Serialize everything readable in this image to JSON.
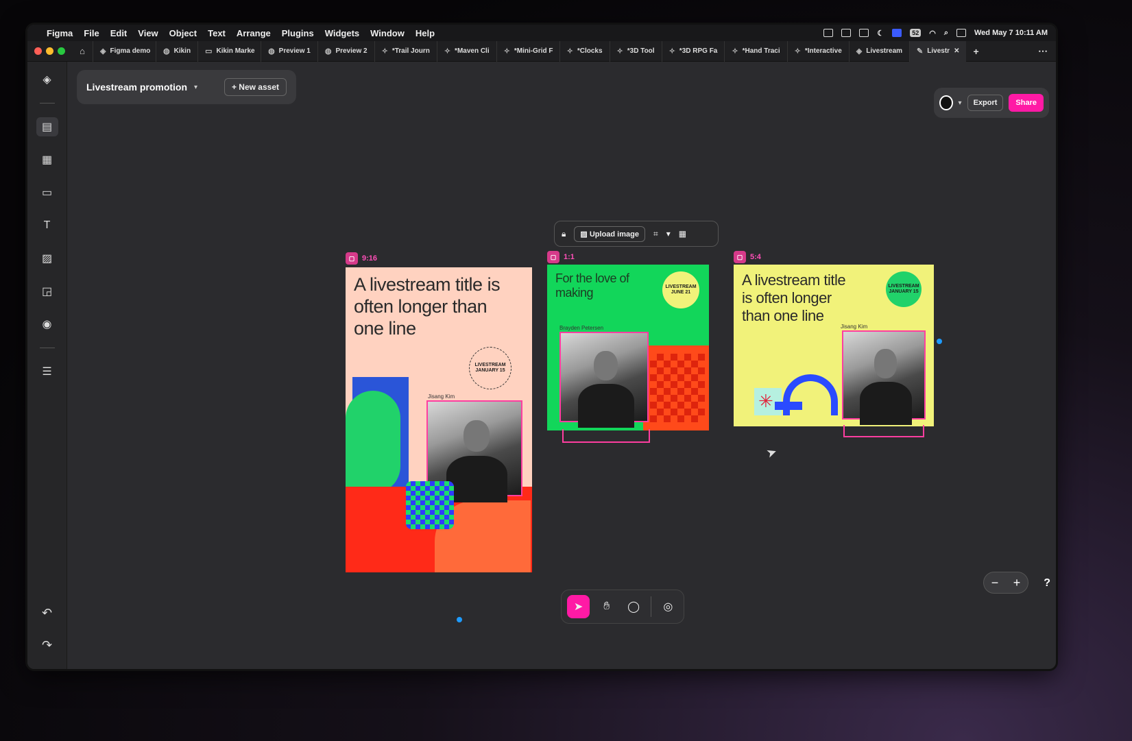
{
  "menubar": {
    "app": "Figma",
    "items": [
      "File",
      "Edit",
      "View",
      "Object",
      "Text",
      "Arrange",
      "Plugins",
      "Widgets",
      "Window",
      "Help"
    ],
    "battery": "52",
    "datetime": "Wed May 7  10:11 AM"
  },
  "tabs": [
    {
      "label": "Figma demo",
      "icon": "figma-icon"
    },
    {
      "label": "Kikin",
      "icon": "globe-icon"
    },
    {
      "label": "Kikin Marke",
      "icon": "book-icon"
    },
    {
      "label": "Preview 1",
      "icon": "globe-icon"
    },
    {
      "label": "Preview 2",
      "icon": "globe-icon"
    },
    {
      "label": "*Trail Journ",
      "icon": "component-icon"
    },
    {
      "label": "*Maven Cli",
      "icon": "component-icon"
    },
    {
      "label": "*Mini-Grid F",
      "icon": "component-icon"
    },
    {
      "label": "*Clocks",
      "icon": "component-icon"
    },
    {
      "label": "*3D Tool",
      "icon": "component-icon"
    },
    {
      "label": "*3D RPG Fa",
      "icon": "component-icon"
    },
    {
      "label": "*Hand Traci",
      "icon": "component-icon"
    },
    {
      "label": "*Interactive",
      "icon": "component-icon"
    },
    {
      "label": "Livestream",
      "icon": "figma-icon"
    },
    {
      "label": "Livestr",
      "icon": "pen-icon",
      "active": true
    }
  ],
  "assetbar": {
    "title": "Livestream promotion",
    "new_asset": "New asset"
  },
  "exportbar": {
    "export": "Export",
    "share": "Share"
  },
  "imagetoolbar": {
    "upload": "Upload image"
  },
  "frames": {
    "f916": {
      "ratio": "9:16",
      "title": "A livestream title is often longer than one line",
      "name": "Jisang Kim",
      "badge": "LIVESTREAM JANUARY 15"
    },
    "f11": {
      "ratio": "1:1",
      "title": "For the love of making",
      "name": "Brayden Petersen",
      "badge": "LIVESTREAM JUNE 21"
    },
    "f54": {
      "ratio": "5:4",
      "title": "A livestream title is often longer than one line",
      "name": "Jisang Kim",
      "badge": "LIVESTREAM JANUARY 15"
    }
  },
  "colors": {
    "accent": "#ff1aa5",
    "selection": "#ff3ea0",
    "frame916": "#ffd2c0",
    "frame11": "#12d65a",
    "frame54": "#f1f27a"
  }
}
